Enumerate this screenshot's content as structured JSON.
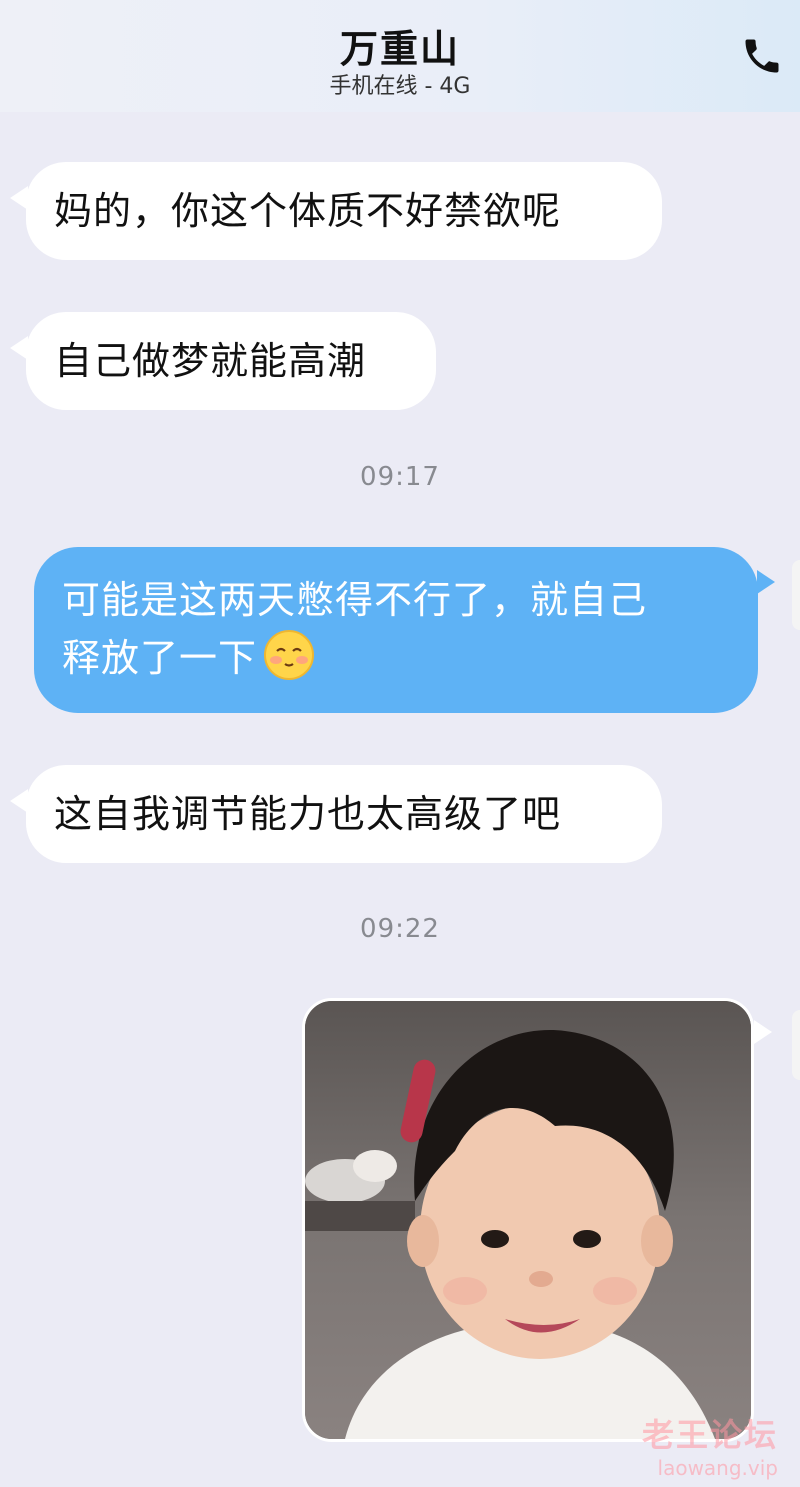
{
  "header": {
    "contact_name": "万重山",
    "status": "手机在线 - 4G",
    "call_icon": "phone-icon"
  },
  "messages": [
    {
      "sender": "contact",
      "text": "妈的，你这个体质不好禁欲呢"
    },
    {
      "sender": "contact",
      "text": "自己做梦就能高潮"
    },
    {
      "type": "timestamp",
      "text": "09:17"
    },
    {
      "sender": "me",
      "lines": [
        "可能是这两天憋得不行了，就自己",
        "释放了一下"
      ],
      "emoji": "blushing-face-emoji"
    },
    {
      "sender": "contact",
      "text": "这自我调节能力也太高级了吧"
    },
    {
      "type": "timestamp",
      "text": "09:22"
    },
    {
      "sender": "me",
      "type": "image",
      "description_icon": "baby-photo"
    }
  ],
  "watermark": {
    "cn": "老王论坛",
    "en": "laowang.vip"
  },
  "colors": {
    "background": "#ebebf5",
    "incoming_bubble": "#ffffff",
    "outgoing_bubble": "#5eb2f5",
    "timestamp": "#888a90"
  }
}
